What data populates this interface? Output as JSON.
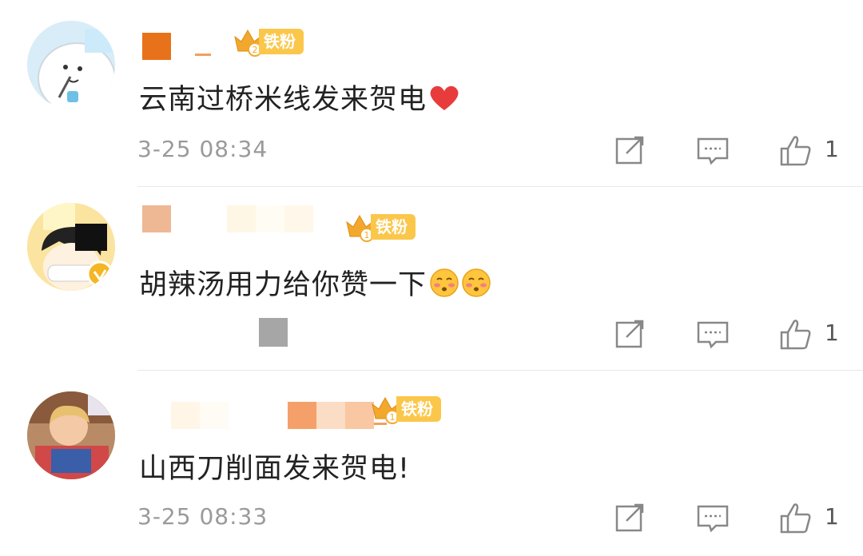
{
  "comments": [
    {
      "text": "云南过桥米线发来贺电",
      "badge": "铁粉",
      "badge_level": "2",
      "time": "3-25 08:34",
      "likes": "1",
      "emoji": "heart-icon"
    },
    {
      "text": "胡辣汤用力给你赞一下",
      "badge": "铁粉",
      "badge_level": "1",
      "time": "",
      "likes": "1",
      "emoji": "blush-face-icon"
    },
    {
      "text": "山西刀削面发来贺电!",
      "badge": "铁粉",
      "badge_level": "1",
      "time": "3-25 08:33",
      "likes": "1",
      "emoji": ""
    }
  ],
  "colors": {
    "badge": "#fbc74b",
    "crown": "#f2a82d",
    "text": "#222222",
    "meta": "#9a9a9a",
    "heart": "#e83c3c"
  },
  "icons": [
    "edit-icon",
    "comment-icon",
    "thumbs-up-icon",
    "crown-icon",
    "verified-icon"
  ]
}
